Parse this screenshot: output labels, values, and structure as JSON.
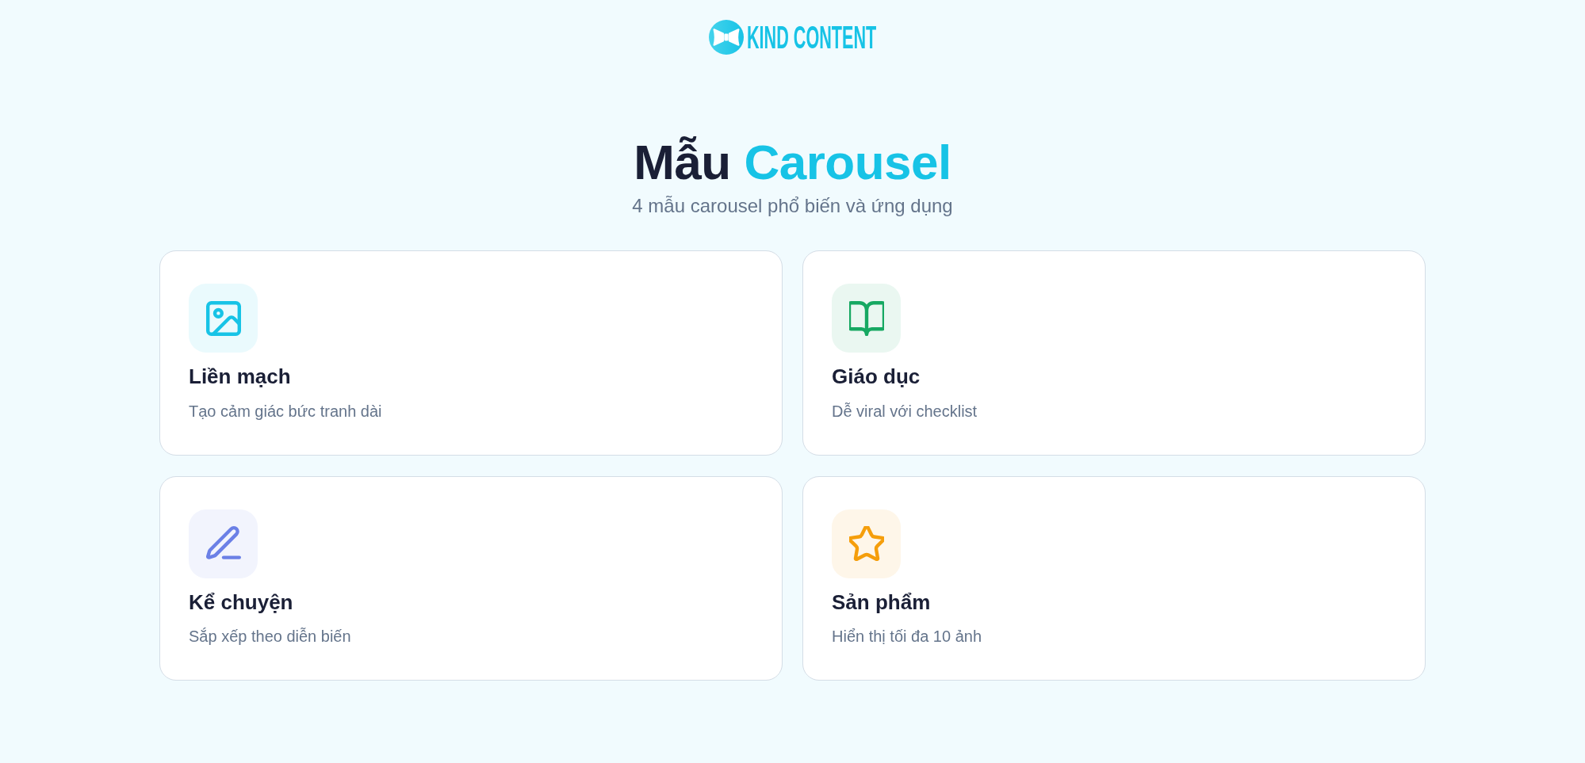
{
  "logo": {
    "text": "KIND CONTENT"
  },
  "heading": {
    "parts": [
      {
        "text": "Mẫu",
        "kind": "plain"
      },
      {
        "text": "Carousel",
        "kind": "accent"
      }
    ],
    "subtitle": "4 mẫu carousel phổ biến và ứng dụng"
  },
  "cards": [
    {
      "kind": "image",
      "color": "#17c3e6",
      "title": "Liền mạch",
      "description": "Tạo cảm giác bức tranh dài"
    },
    {
      "kind": "book",
      "color": "#16a862",
      "title": "Giáo dục",
      "description": "Dễ viral với checklist"
    },
    {
      "kind": "pencil",
      "color": "#6b80e6",
      "title": "Kể chuyện",
      "description": "Sắp xếp theo diễn biến"
    },
    {
      "kind": "star",
      "color": "#f59e0b",
      "title": "Sản phẩm",
      "description": "Hiển thị tối đa 10 ảnh"
    }
  ]
}
